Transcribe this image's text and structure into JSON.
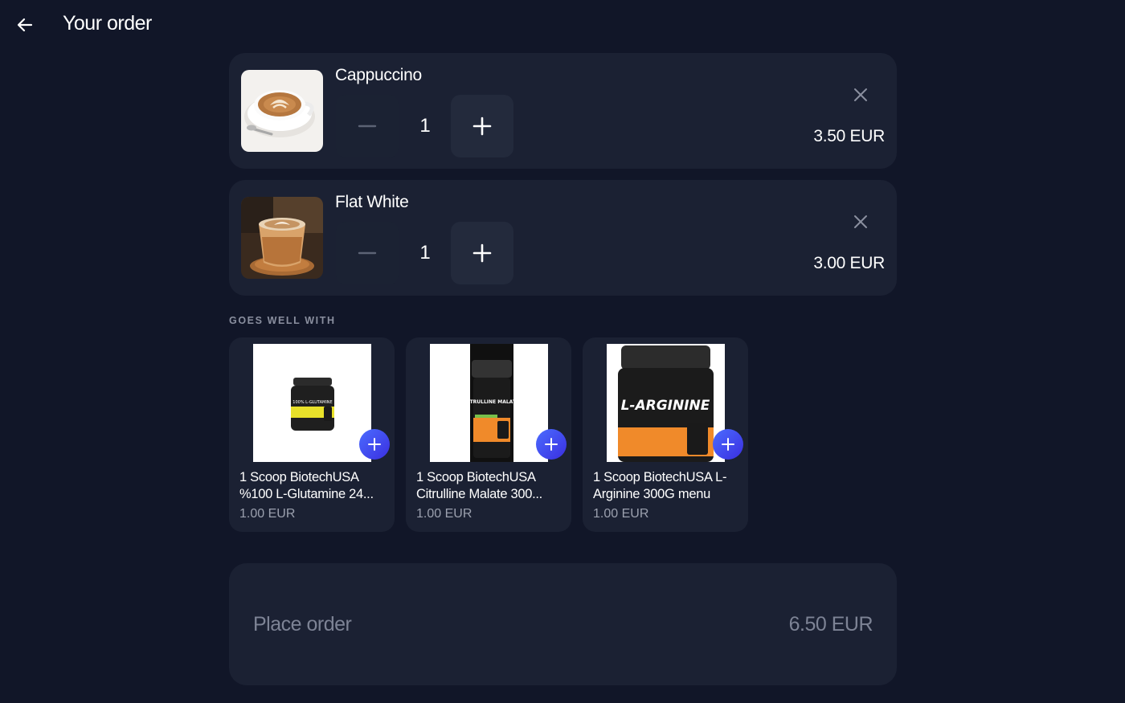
{
  "header": {
    "title": "Your order"
  },
  "order_items": [
    {
      "name": "Cappuccino",
      "quantity": "1",
      "price": "3.50 EUR",
      "image": "cappuccino-photo"
    },
    {
      "name": "Flat White",
      "quantity": "1",
      "price": "3.00 EUR",
      "image": "flat-white-photo"
    }
  ],
  "recommendations": {
    "label": "GOES WELL WITH",
    "items": [
      {
        "name": "1 Scoop BiotechUSA %100 L-Glutamine 24...",
        "price": "1.00 EUR",
        "image": "glutamine-jar",
        "label_text": "100% L-GLUTAMINE"
      },
      {
        "name": "1 Scoop BiotechUSA Citrulline Malate 300...",
        "price": "1.00 EUR",
        "image": "citrulline-jar",
        "label_text": "CITRULLINE MALATE"
      },
      {
        "name": "1 Scoop BiotechUSA L-Arginine 300G menu",
        "price": "1.00 EUR",
        "image": "arginine-jar",
        "label_text": "L-ARGININE"
      }
    ]
  },
  "footer": {
    "place_order_label": "Place order",
    "total": "6.50 EUR"
  },
  "colors": {
    "background": "#111628",
    "card": "#1b2133",
    "accent": "#4b6cff"
  }
}
